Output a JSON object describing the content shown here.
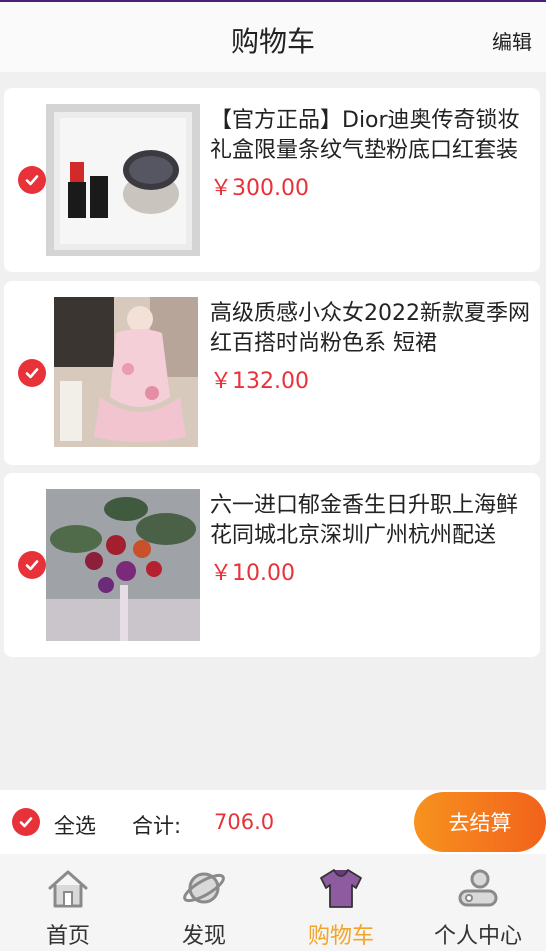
{
  "header": {
    "title": "购物车",
    "edit_label": "编辑"
  },
  "items": [
    {
      "title": "【官方正品】Dior迪奥传奇锁妆礼盒限量条纹气垫粉底口红套装",
      "price": "￥300.00",
      "checked": true
    },
    {
      "title": "高级质感小众女2022新款夏季网红百搭时尚粉色系 短裙",
      "price": "￥132.00",
      "checked": true
    },
    {
      "title": " 六一进口郁金香生日升职上海鲜花同城北京深圳广州杭州配送",
      "price": "￥10.00",
      "checked": true
    }
  ],
  "footer": {
    "select_all_label": "全选",
    "total_label": "合计:",
    "total_value": "706.0",
    "checkout_label": "去结算"
  },
  "tabs": [
    {
      "label": "首页",
      "icon": "home-icon",
      "active": false
    },
    {
      "label": "发现",
      "icon": "planet-icon",
      "active": false
    },
    {
      "label": "购物车",
      "icon": "shirt-icon",
      "active": true
    },
    {
      "label": "个人中心",
      "icon": "user-icon",
      "active": false
    }
  ],
  "colors": {
    "accent": "#e8323a",
    "checkout": "#f57a1e",
    "active_tab": "#f2a52a",
    "shirt_icon": "#8e5aa0"
  }
}
